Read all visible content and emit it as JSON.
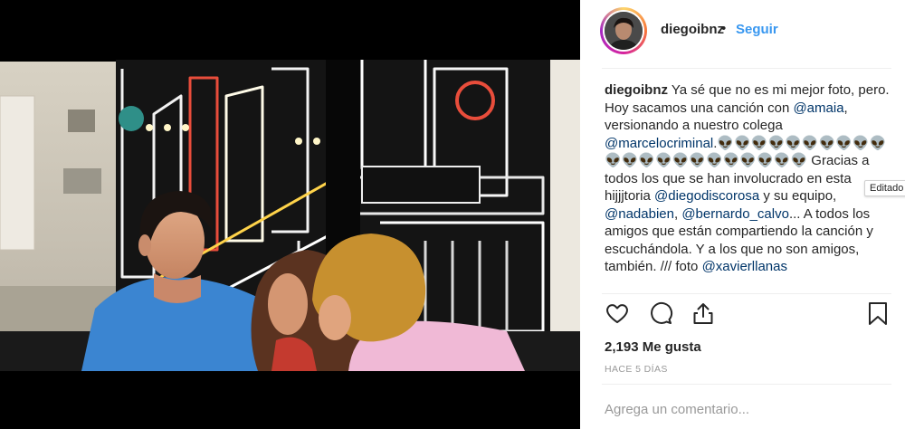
{
  "post": {
    "username": "diegoibnz",
    "separator": "•",
    "follow_label": "Seguir",
    "caption": {
      "author": "diegoibnz",
      "segments": [
        {
          "type": "text",
          "value": " Ya sé que no es mi mejor foto, pero. Hoy sacamos una canción con "
        },
        {
          "type": "mention",
          "value": "@amaia"
        },
        {
          "type": "text",
          "value": ", versionando a nuestro colega "
        },
        {
          "type": "mention",
          "value": "@marcelocriminal"
        },
        {
          "type": "text",
          "value": ".👽👽👽👽👽👽👽👽👽👽👽👽👽👽👽👽👽👽👽👽👽👽 Gracias a todos los que se han involucrado en esta hijjjtoria "
        },
        {
          "type": "mention",
          "value": "@diegodiscorosa"
        },
        {
          "type": "text",
          "value": " y su equipo, "
        },
        {
          "type": "mention",
          "value": "@nadabien"
        },
        {
          "type": "text",
          "value": ", "
        },
        {
          "type": "mention",
          "value": "@bernardo_calvo"
        },
        {
          "type": "text",
          "value": "... A todos los amigos que están compartiendo la canción y escuchándola. Y a los que no son amigos, también. /// foto "
        },
        {
          "type": "mention",
          "value": "@xavierllanas"
        }
      ]
    },
    "edited_tooltip": "Editado",
    "likes_text": "2,193 Me gusta",
    "timestamp": "HACE 5 DÍAS",
    "comment_placeholder": "Agrega un comentario...",
    "colors": {
      "accent": "#3897f0",
      "mention": "#003569",
      "text": "#262626",
      "muted": "#999999",
      "divider": "#efefef"
    },
    "icons": {
      "like": "heart-icon",
      "comment": "speech-bubble-icon",
      "share": "share-arrow-icon",
      "save": "bookmark-icon",
      "tag": "user-tag-icon"
    }
  }
}
